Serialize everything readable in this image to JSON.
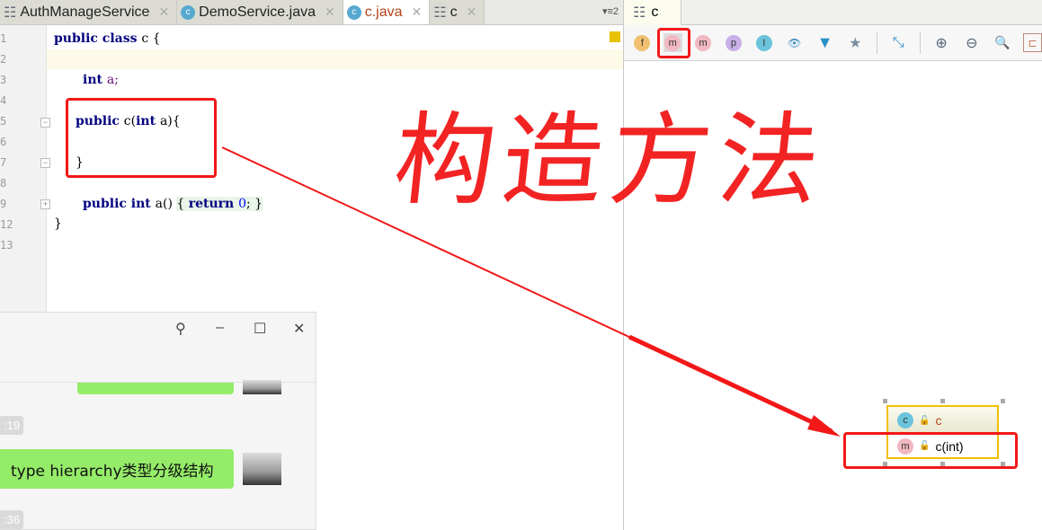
{
  "editor": {
    "tabs": [
      {
        "label": "AuthManageService",
        "icon": "hierarchy-icon"
      },
      {
        "label": "DemoService.java",
        "icon": "class-icon"
      },
      {
        "label": "c.java",
        "icon": "class-icon",
        "active": true
      },
      {
        "label": "c",
        "icon": "hierarchy-icon"
      }
    ],
    "tab_menu": "▾≡2",
    "line_numbers": [
      "1",
      "2",
      "3",
      "4",
      "5",
      "6",
      "7",
      "8",
      "9",
      "12",
      "13"
    ],
    "code": {
      "l1": [
        "public class ",
        "c {"
      ],
      "l3": [
        "int ",
        "a;"
      ],
      "l5": [
        "public ",
        "c(",
        "int ",
        "a){"
      ],
      "l7": "}",
      "l9": [
        "public int ",
        "a() ",
        "{ ",
        "return ",
        "0",
        ";",
        " }"
      ],
      "l12": "}"
    }
  },
  "hierarchy": {
    "tab_label": "c",
    "toolbar": [
      {
        "icon": "field-icon",
        "glyph": "f",
        "color": "#f0c070"
      },
      {
        "icon": "inherited-methods-icon",
        "glyph": "m",
        "color": "#f2b8c2",
        "selected": true
      },
      {
        "icon": "method-icon",
        "glyph": "m",
        "color": "#f2b8c2"
      },
      {
        "icon": "property-icon",
        "glyph": "p",
        "color": "#c9b0e8"
      },
      {
        "icon": "interface-icon",
        "glyph": "I",
        "color": "#6cc4dc"
      }
    ],
    "diagram": {
      "class_name": "c",
      "member": "c(int)",
      "class_glyph": "c",
      "member_glyph": "m"
    }
  },
  "chat": {
    "message": "type hierarchy类型分级结构",
    "times": [
      ":19",
      ":36"
    ]
  },
  "annotation": {
    "handwriting": "构造方法",
    "color": "#f21818"
  }
}
